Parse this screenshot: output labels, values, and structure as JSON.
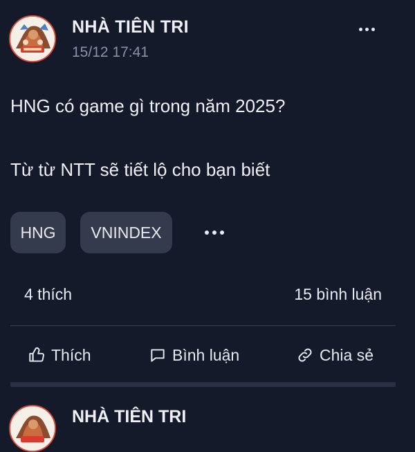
{
  "post": {
    "author": "NHÀ TIÊN TRI",
    "timestamp": "15/12 17:41",
    "content_line1": "HNG có game gì trong năm 2025?",
    "content_line2": "Từ từ NTT sẽ tiết lộ cho bạn biết",
    "tags": [
      "HNG",
      "VNINDEX"
    ],
    "likes_text": "4 thích",
    "comments_text": "15 bình luận",
    "actions": {
      "like": "Thích",
      "comment": "Bình luận",
      "share": "Chia sẻ"
    },
    "icons": {
      "more": "more-horizontal-icon",
      "tags_more": "more-horizontal-icon",
      "like": "thumbs-up-icon",
      "comment": "comment-bubble-icon",
      "share": "link-icon"
    }
  },
  "next_post": {
    "author": "NHÀ TIÊN TRI"
  },
  "colors": {
    "background": "#151a2b",
    "tag_background": "#343b4d",
    "muted_text": "#8a92a8",
    "divider": "#3b4256"
  }
}
